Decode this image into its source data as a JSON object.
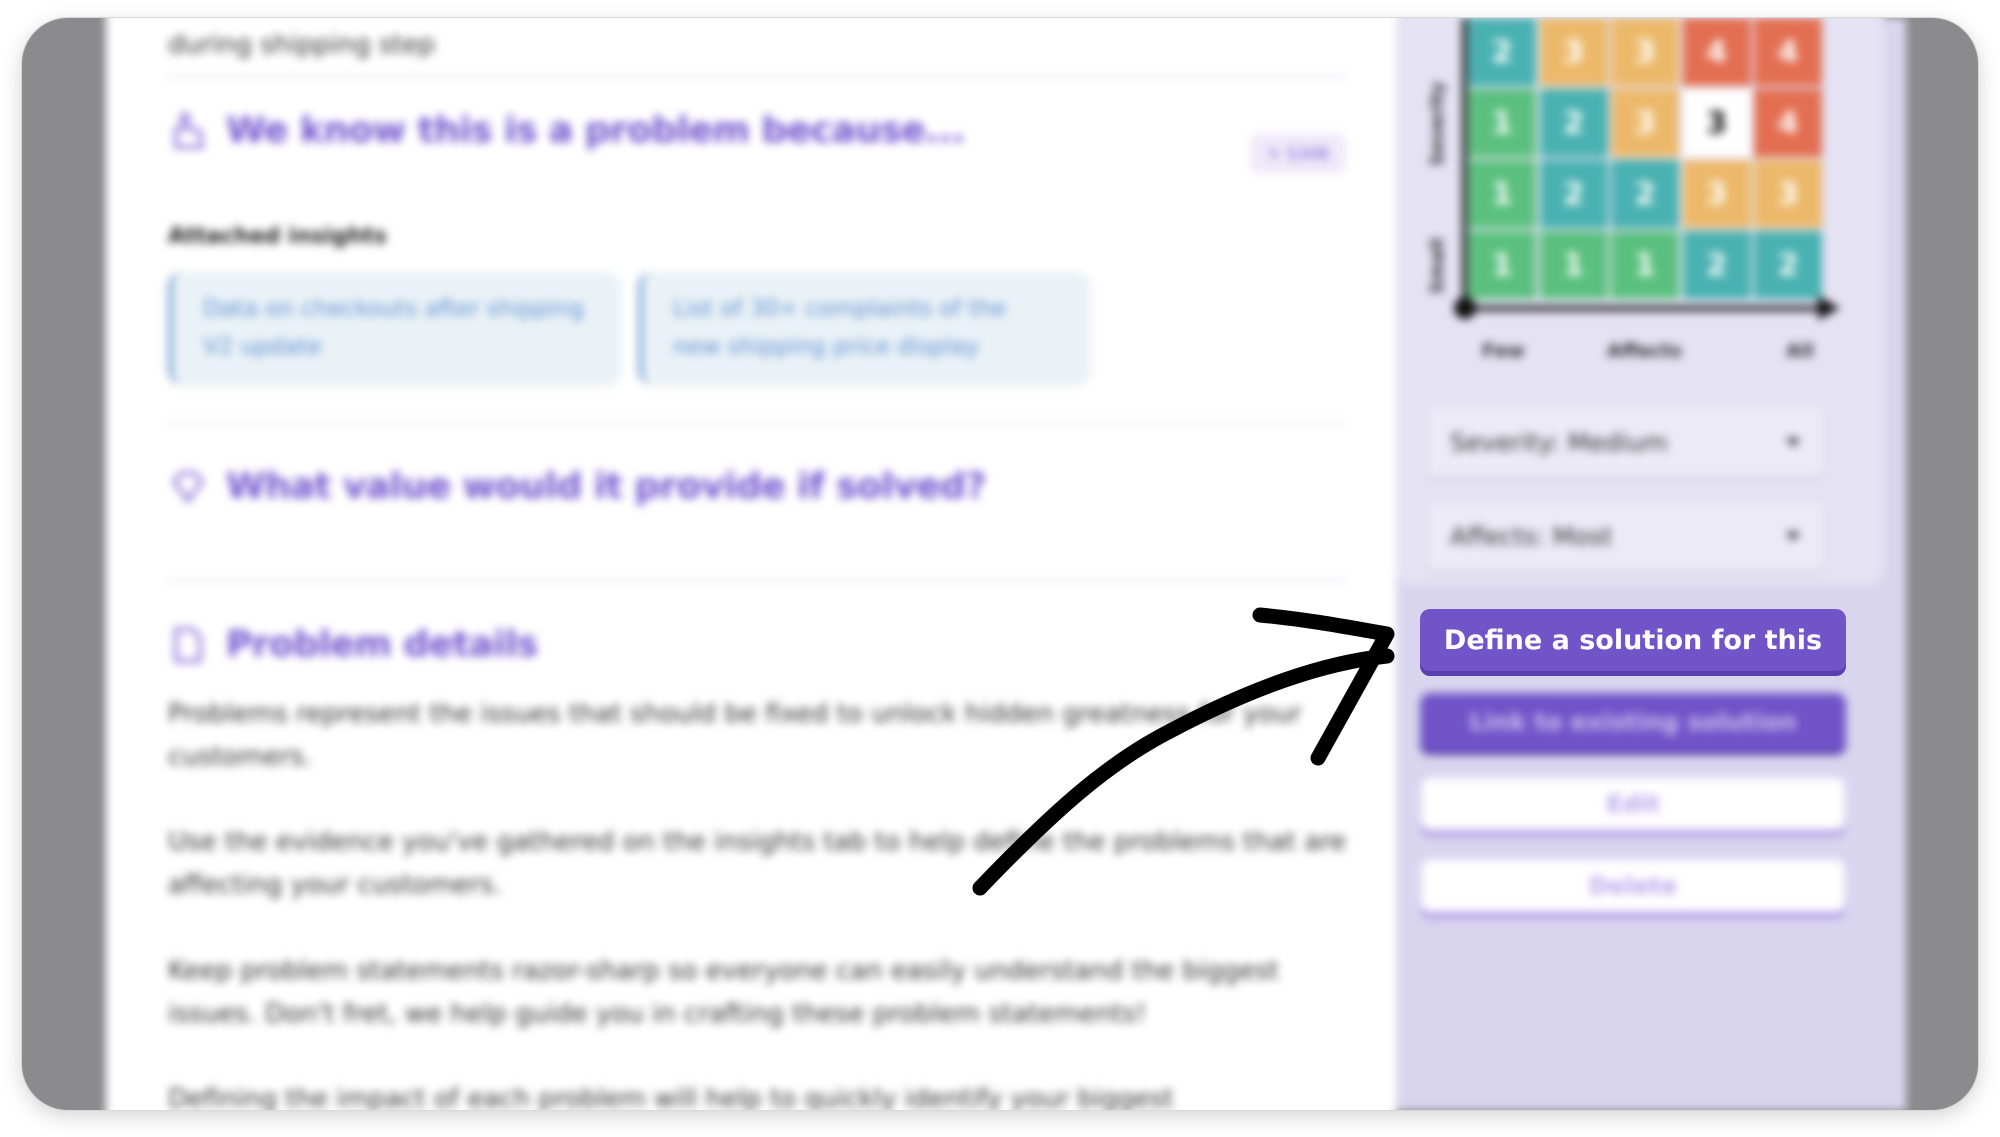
{
  "content": {
    "top_partial_text": "during shipping step",
    "problem_section": {
      "title": "We know this is a problem because...",
      "link_label": "+ Link",
      "attached_label": "Attached insights",
      "insights": [
        {
          "text": "Data on checkouts after shipping V2 update"
        },
        {
          "text": "List of 30+ complaints of the new shipping price display"
        }
      ]
    },
    "value_section": {
      "title": "What value would it provide if solved?"
    },
    "details_section": {
      "title": "Problem details",
      "paragraphs": [
        "Problems represent the issues that should be fixed to unlock hidden greatness for your customers.",
        "Use the evidence you've gathered on the insights tab to help define the problems that are affecting your customers.",
        "Keep problem statements razor-sharp so everyone can easily understand the biggest issues. Don't fret, we help guide you in crafting these problem statements!",
        "Defining the impact of each problem will help to quickly identify your biggest"
      ]
    }
  },
  "sidebar": {
    "matrix": {
      "y_axis_label": "Severity",
      "y_axis_low_label": "Small",
      "x_axis_label": "Affects",
      "x_axis_low_label": "Few",
      "x_axis_high_label": "All",
      "rows": [
        [
          "2",
          "3",
          "3",
          "4",
          "4"
        ],
        [
          "1",
          "2",
          "3",
          "3",
          "4"
        ],
        [
          "1",
          "2",
          "2",
          "3",
          "3"
        ],
        [
          "1",
          "1",
          "1",
          "2",
          "2"
        ]
      ],
      "selected": {
        "row": 1,
        "col": 3
      },
      "colors": {
        "1": "#5bc07f",
        "2": "#49b1b1",
        "3": "#ecb96b",
        "4": "#e36f52",
        "selected_bg": "#ffffff",
        "selected_text": "#111111"
      }
    },
    "severity_select": {
      "value": "Severity: Medium"
    },
    "affects_select": {
      "value": "Affects: Most"
    },
    "buttons": {
      "define_solution": "Define a solution for this",
      "link_existing": "Link to existing solution",
      "edit": "Edit",
      "delete": "Delete"
    }
  },
  "colors": {
    "accent": "#7054c8",
    "title_purple": "#7356cf",
    "annotation_arrow": "#000000"
  }
}
